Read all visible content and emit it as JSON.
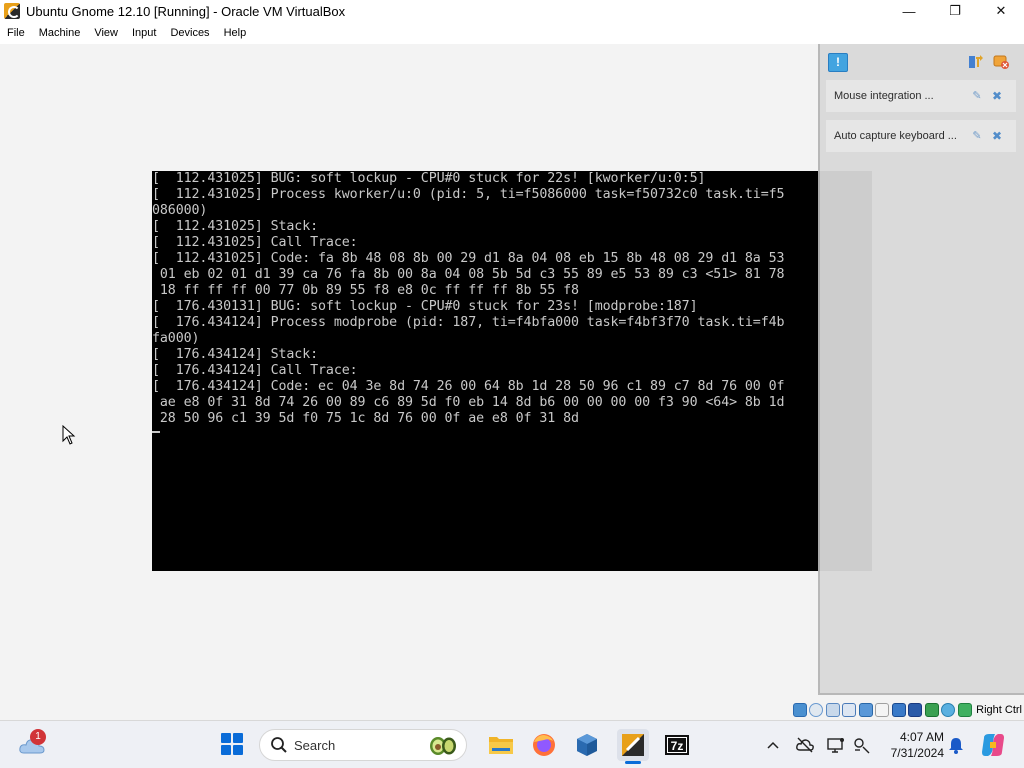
{
  "window": {
    "title": "Ubuntu Gnome 12.10 [Running] - Oracle VM VirtualBox",
    "minimize": "—",
    "maximize": "❐",
    "close": "✕"
  },
  "menu": [
    "File",
    "Machine",
    "View",
    "Input",
    "Devices",
    "Help"
  ],
  "console": {
    "lines": [
      "[  112.431025] BUG: soft lockup - CPU#0 stuck for 22s! [kworker/u:0:5]",
      "[  112.431025] Process kworker/u:0 (pid: 5, ti=f5086000 task=f50732c0 task.ti=f5",
      "086000)",
      "[  112.431025] Stack:",
      "[  112.431025] Call Trace:",
      "[  112.431025] Code: fa 8b 48 08 8b 00 29 d1 8a 04 08 eb 15 8b 48 08 29 d1 8a 53",
      " 01 eb 02 01 d1 39 ca 76 fa 8b 00 8a 04 08 5b 5d c3 55 89 e5 53 89 c3 <51> 81 78",
      " 18 ff ff ff 00 77 0b 89 55 f8 e8 0c ff ff ff 8b 55 f8",
      "[  176.430131] BUG: soft lockup - CPU#0 stuck for 23s! [modprobe:187]",
      "[  176.434124] Process modprobe (pid: 187, ti=f4bfa000 task=f4bf3f70 task.ti=f4b",
      "fa000)",
      "[  176.434124] Stack:",
      "[  176.434124] Call Trace:",
      "[  176.434124] Code: ec 04 3e 8d 74 26 00 64 8b 1d 28 50 96 c1 89 c7 8d 76 00 0f",
      " ae e8 0f 31 8d 74 26 00 89 c6 89 5d f0 eb 14 8d b6 00 00 00 00 f3 90 <64> 8b 1d",
      " 28 50 96 c1 39 5d f0 75 1c 8d 76 00 0f ae e8 0f 31 8d"
    ]
  },
  "notifications": {
    "items": [
      {
        "text": "Mouse integration ..."
      },
      {
        "text": "Auto capture keyboard ..."
      }
    ]
  },
  "statusbar": {
    "host_key": "Right Ctrl"
  },
  "taskbar": {
    "weather_badge": "1",
    "search_placeholder": "Search",
    "clock_time": "4:07 AM",
    "clock_date": "7/31/2024"
  },
  "colors": {
    "accent": "#0a6cd8",
    "console_bg": "#000000",
    "console_fg": "#c8c8c8",
    "badge": "#d13438"
  }
}
